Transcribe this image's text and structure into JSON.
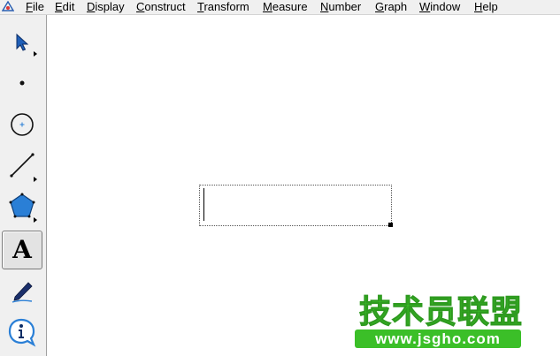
{
  "menubar": {
    "items": [
      {
        "first": "F",
        "rest": "ile"
      },
      {
        "first": "E",
        "rest": "dit"
      },
      {
        "first": "D",
        "rest": "isplay"
      },
      {
        "first": "C",
        "rest": "onstruct"
      },
      {
        "first": "T",
        "rest": "ransform"
      },
      {
        "first": "M",
        "rest": "easure"
      },
      {
        "first": "N",
        "rest": "umber"
      },
      {
        "first": "G",
        "rest": "raph"
      },
      {
        "first": "W",
        "rest": "indow"
      },
      {
        "first": "H",
        "rest": "elp"
      }
    ]
  },
  "toolbox": {
    "tools": [
      {
        "icon": "selection-arrow-icon",
        "has_submenu": true
      },
      {
        "icon": "point-icon",
        "has_submenu": false
      },
      {
        "icon": "compass-circle-icon",
        "has_submenu": false
      },
      {
        "icon": "straightedge-icon",
        "has_submenu": true
      },
      {
        "icon": "polygon-icon",
        "has_submenu": true
      },
      {
        "icon": "text-tool-icon",
        "label": "A",
        "has_submenu": false,
        "selected": true
      },
      {
        "icon": "marker-icon",
        "has_submenu": false
      },
      {
        "icon": "information-icon",
        "has_submenu": false
      }
    ]
  },
  "canvas": {
    "text_box": {
      "value": ""
    }
  },
  "watermark": {
    "title": "技术员联盟",
    "url": "www.jsgho.com"
  },
  "colors": {
    "chrome": "#f0f0f0",
    "tool_blue": "#2a7fd6",
    "watermark_green": "#3bbf28"
  }
}
